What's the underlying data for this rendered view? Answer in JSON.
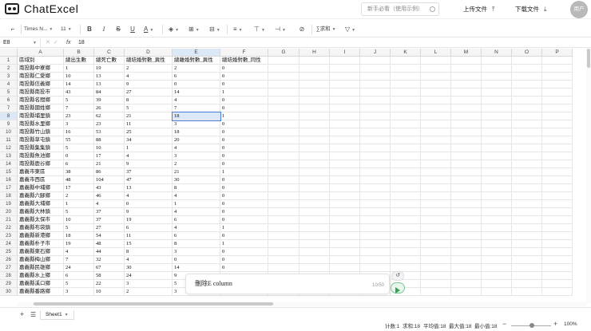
{
  "app": {
    "logo_text": "ChatExcel"
  },
  "topbar": {
    "guide_placeholder": "新手必看（使用示例）",
    "upload_label": "上传文件",
    "download_label": "下载文件",
    "user_label": "用户"
  },
  "toolbar": {
    "font_name": "Times N...",
    "font_size": "11",
    "bold": "B",
    "italic": "I",
    "strike": "S",
    "underline": "U",
    "text_color": "A",
    "sum_label": "求和"
  },
  "formula_bar": {
    "cell_ref": "E8",
    "fx": "fx",
    "value": "18"
  },
  "grid": {
    "columns": [
      "A",
      "B",
      "C",
      "D",
      "E",
      "F",
      "G",
      "H",
      "I",
      "J",
      "K",
      "L",
      "M",
      "N",
      "O",
      "P"
    ],
    "headers": [
      "區域別",
      "總出生數",
      "總死亡數",
      "總結婚對數_異性",
      "總離婚對數_異性",
      "總結婚對數_同性"
    ],
    "rows": [
      [
        "南投縣中寮鄉",
        "1",
        "19",
        "2",
        "2",
        "0"
      ],
      [
        "南投縣仁愛鄉",
        "10",
        "13",
        "4",
        "6",
        "0"
      ],
      [
        "南投縣信義鄉",
        "14",
        "13",
        "9",
        "0",
        "0"
      ],
      [
        "南投縣南投市",
        "43",
        "84",
        "27",
        "14",
        "1"
      ],
      [
        "南投縣名間鄉",
        "5",
        "39",
        "8",
        "4",
        "0"
      ],
      [
        "南投縣國姓鄉",
        "7",
        "26",
        "5",
        "7",
        "0"
      ],
      [
        "南投縣埔里鎮",
        "23",
        "62",
        "21",
        "18",
        "1"
      ],
      [
        "南投縣水里鄉",
        "3",
        "23",
        "11",
        "3",
        "0"
      ],
      [
        "南投縣竹山鎮",
        "16",
        "53",
        "25",
        "18",
        "0"
      ],
      [
        "南投縣草屯鎮",
        "55",
        "88",
        "34",
        "20",
        "0"
      ],
      [
        "南投縣集集鎮",
        "5",
        "10",
        "1",
        "4",
        "0"
      ],
      [
        "南投縣魚池鄉",
        "0",
        "17",
        "4",
        "3",
        "0"
      ],
      [
        "南投縣鹿谷鄉",
        "6",
        "21",
        "9",
        "2",
        "0"
      ],
      [
        "嘉義市東區",
        "38",
        "86",
        "37",
        "21",
        "1"
      ],
      [
        "嘉義市西區",
        "48",
        "104",
        "47",
        "30",
        "0"
      ],
      [
        "嘉義縣中埔鄉",
        "17",
        "43",
        "13",
        "8",
        "0"
      ],
      [
        "嘉義縣六腳鄉",
        "2",
        "46",
        "4",
        "4",
        "0"
      ],
      [
        "嘉義縣大埔鄉",
        "1",
        "4",
        "0",
        "1",
        "0"
      ],
      [
        "嘉義縣大林鎮",
        "5",
        "37",
        "9",
        "4",
        "0"
      ],
      [
        "嘉義縣太保市",
        "10",
        "37",
        "19",
        "6",
        "0"
      ],
      [
        "嘉義縣布袋鎮",
        "5",
        "27",
        "6",
        "4",
        "1"
      ],
      [
        "嘉義縣新港鄉",
        "18",
        "54",
        "11",
        "6",
        "0"
      ],
      [
        "嘉義縣朴子市",
        "19",
        "48",
        "15",
        "8",
        "1"
      ],
      [
        "嘉義縣東石鄉",
        "4",
        "44",
        "8",
        "3",
        "0"
      ],
      [
        "嘉義縣梅山鄉",
        "7",
        "32",
        "4",
        "0",
        "0"
      ],
      [
        "嘉義縣民雄鄉",
        "24",
        "67",
        "30",
        "14",
        "0"
      ],
      [
        "嘉義縣水上鄉",
        "6",
        "58",
        "24",
        "9",
        "0"
      ],
      [
        "嘉義縣溪口鄉",
        "5",
        "22",
        "3",
        "5",
        "0"
      ],
      [
        "嘉義縣番路鄉",
        "3",
        "10",
        "2",
        "3",
        "0"
      ]
    ]
  },
  "chat": {
    "input_text": "刪除E column",
    "counter": "10/50"
  },
  "sheets": {
    "active": "Sheet1"
  },
  "status": {
    "count": "计数:1",
    "sum": "求和:18",
    "avg": "平均值:18",
    "max": "最大值:18",
    "min": "最小值:18",
    "zoom": "100%"
  },
  "colors": {
    "accent": "#4a7fd8",
    "selection_fill": "#dce8f9",
    "send_green": "#3c9e5c"
  }
}
